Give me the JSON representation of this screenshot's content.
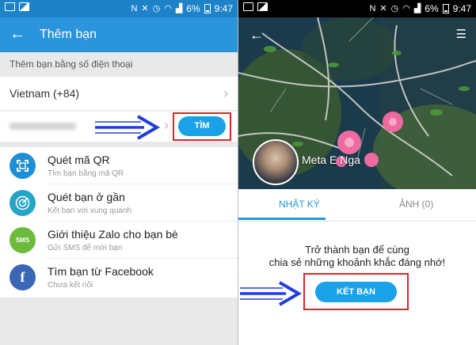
{
  "left": {
    "statusbar": {
      "battery": "6%",
      "time": "9:47"
    },
    "appbar": {
      "back_glyph": "←",
      "title": "Thêm bạn"
    },
    "section_header": "Thêm bạn bằng số điện thoại",
    "country": "Vietnam (+84)",
    "find_button": "TÌM",
    "options": [
      {
        "icon": "qr-scan-icon",
        "icon_text": "",
        "color": "#1c8fd6",
        "title": "Quét mã QR",
        "subtitle": "Tìm bạn bằng mã QR"
      },
      {
        "icon": "radar-icon",
        "icon_text": "",
        "color": "#25a5c6",
        "title": "Quét bạn ở gần",
        "subtitle": "Kết bạn với xung quanh"
      },
      {
        "icon": "sms-icon",
        "icon_text": "SMS",
        "color": "#6cbb3c",
        "title": "Giới thiệu Zalo cho bạn bè",
        "subtitle": "Gửi SMS để mời bạn"
      },
      {
        "icon": "facebook-icon",
        "icon_text": "f",
        "color": "#3b65b5",
        "title": "Tìm bạn từ Facebook",
        "subtitle": "Chưa kết nối"
      }
    ]
  },
  "right": {
    "statusbar": {
      "battery": "6%",
      "time": "9:47"
    },
    "profile_name": "Meta E Nga",
    "tabs": {
      "diary": "NHẬT KÝ",
      "photos": "ẢNH (0)"
    },
    "message_line1": "Trở thành bạn để cùng",
    "message_line2": "chia sẻ những khoảnh khắc đáng nhớ!",
    "add_friend_button": "KẾT BẠN"
  },
  "colors": {
    "accent_blue": "#2a95dc",
    "button_blue": "#1aa2e8",
    "highlight_red": "#d9252a",
    "pointer_arrow_blue": "#1f3fd8"
  }
}
